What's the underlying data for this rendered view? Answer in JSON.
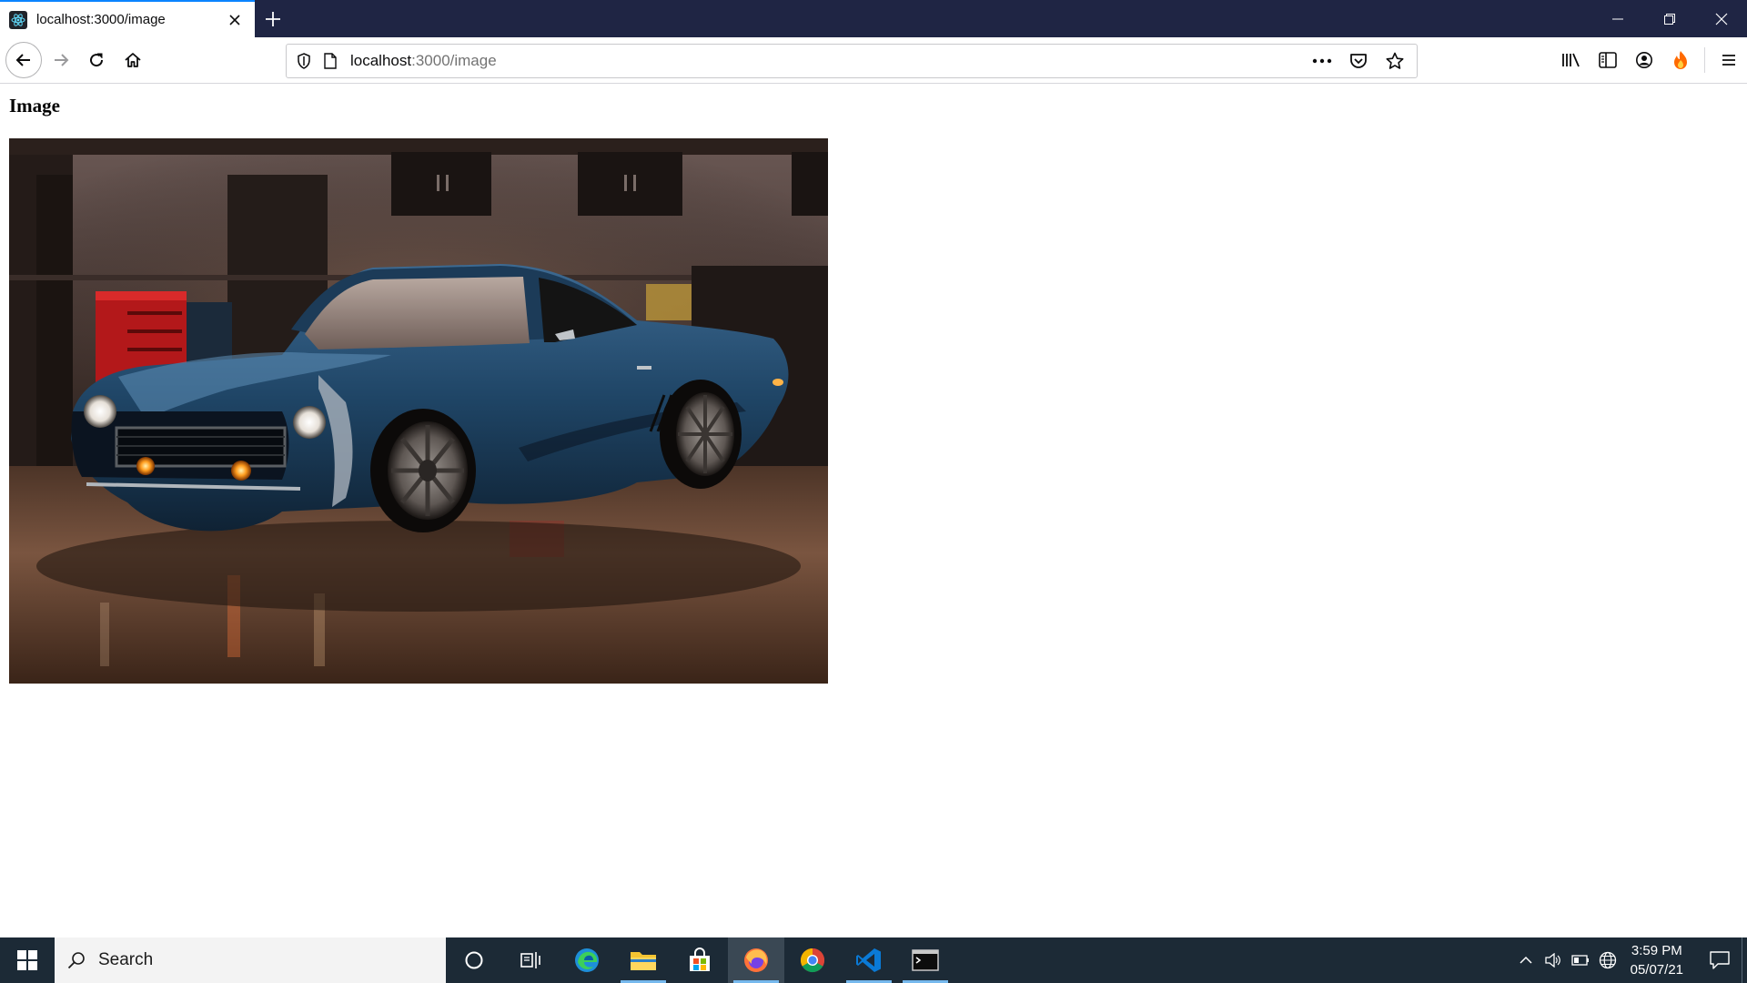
{
  "browser": {
    "tab": {
      "title": "localhost:3000/image",
      "favicon": "react-icon"
    },
    "url": {
      "host": "localhost",
      "path": ":3000/image"
    },
    "accent_color": "#0a84ff",
    "tabstrip_color": "#1f2544"
  },
  "page": {
    "heading": "Image",
    "image": {
      "alt": "Blue classic muscle car parked in a garage"
    }
  },
  "taskbar": {
    "search_placeholder": "Search",
    "time": "3:59 PM",
    "date": "05/07/21",
    "apps": [
      "cortana-icon",
      "task-view-icon",
      "edge-icon",
      "file-explorer-icon",
      "store-icon",
      "firefox-icon",
      "chrome-icon",
      "vscode-icon",
      "terminal-icon"
    ]
  }
}
